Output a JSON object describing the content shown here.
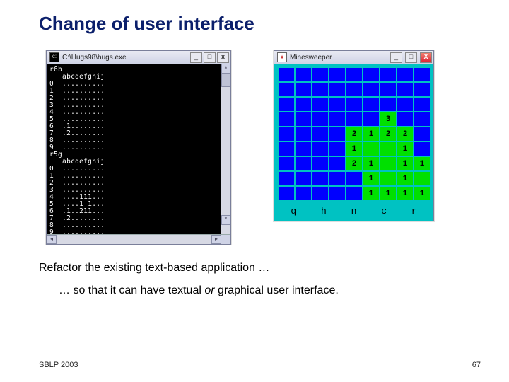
{
  "slide": {
    "title": "Change of user interface",
    "line1": "Refactor the existing text-based application …",
    "line2_a": "… so that it can have textual ",
    "line2_or": "or",
    "line2_b": " graphical user interface.",
    "footer_left": "SBLP 2003",
    "footer_right": "67"
  },
  "console_window": {
    "title": "C:\\Hugs98\\hugs.exe",
    "btn_min": "_",
    "btn_max": "□",
    "btn_close": "x",
    "text": "r6b\n   abcdefghij\n0  ..........\n1  ..........\n2  ..........\n3  ..........\n4  ..........\n5  ..........\n6  .1........\n7  .2........\n8  ..........\n9  ..........\nr5g\n   abcdefghij\n0  ..........\n1  ..........\n2  ..........\n3  ..........\n4  ....111...\n5  ....1 1...\n6  .1..211...\n7  .2........\n8  ..........\n9  .........."
  },
  "mine_window": {
    "title": "Minesweeper",
    "btn_min": "_",
    "btn_max": "□",
    "btn_close": "X",
    "labels": [
      "q",
      "h",
      "n",
      "c",
      "r"
    ],
    "grid": [
      [
        "",
        "",
        "",
        "",
        "",
        "",
        "",
        "",
        ""
      ],
      [
        "",
        "",
        "",
        "",
        "",
        "",
        "",
        "",
        ""
      ],
      [
        "",
        "",
        "",
        "",
        "",
        "",
        "",
        "",
        ""
      ],
      [
        "",
        "",
        "",
        "",
        "",
        "",
        "3",
        "",
        ""
      ],
      [
        "",
        "",
        "",
        "",
        "2",
        "1",
        "2",
        "2",
        ""
      ],
      [
        "",
        "",
        "",
        "",
        "1",
        "",
        "",
        "1",
        ""
      ],
      [
        "",
        "",
        "",
        "",
        "2",
        "1",
        "",
        "1",
        "1"
      ],
      [
        "",
        "",
        "",
        "",
        "",
        "1",
        "",
        "1",
        ""
      ],
      [
        "",
        "",
        "",
        "",
        "",
        "1",
        "1",
        "1",
        "1"
      ]
    ],
    "open": [
      [
        0,
        0,
        0,
        0,
        0,
        0,
        0,
        0,
        0
      ],
      [
        0,
        0,
        0,
        0,
        0,
        0,
        0,
        0,
        0
      ],
      [
        0,
        0,
        0,
        0,
        0,
        0,
        0,
        0,
        0
      ],
      [
        0,
        0,
        0,
        0,
        0,
        0,
        1,
        0,
        0
      ],
      [
        0,
        0,
        0,
        0,
        1,
        1,
        1,
        1,
        0
      ],
      [
        0,
        0,
        0,
        0,
        1,
        1,
        1,
        1,
        0
      ],
      [
        0,
        0,
        0,
        0,
        1,
        1,
        1,
        1,
        1
      ],
      [
        0,
        0,
        0,
        0,
        0,
        1,
        1,
        1,
        1
      ],
      [
        0,
        0,
        0,
        0,
        0,
        1,
        1,
        1,
        1
      ]
    ]
  }
}
